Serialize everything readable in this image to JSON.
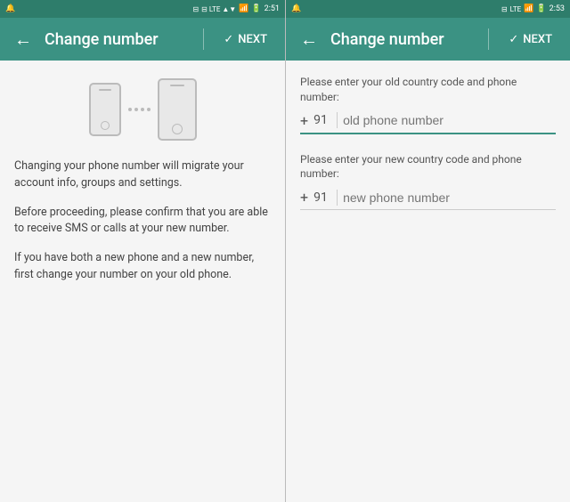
{
  "screen1": {
    "statusBar": {
      "left": "🔔",
      "icons": "⊟ LTE ▲▼",
      "signal": "📶",
      "battery": "🔋",
      "time": "2:51"
    },
    "toolbar": {
      "backIcon": "←",
      "title": "Change number",
      "checkIcon": "✓",
      "nextLabel": "NEXT"
    },
    "illustration": {
      "dots": [
        "•",
        "•",
        "•",
        "•"
      ]
    },
    "paragraphs": [
      "Changing your phone number will migrate your account info, groups and settings.",
      "Before proceeding, please confirm that you are able to receive SMS or calls at your new number.",
      "If you have both a new phone and a new number, first change your number on your old phone."
    ]
  },
  "screen2": {
    "statusBar": {
      "icons": "⊟ LTE ▲▼",
      "time": "2:53"
    },
    "toolbar": {
      "backIcon": "←",
      "title": "Change number",
      "checkIcon": "✓",
      "nextLabel": "NEXT"
    },
    "oldNumberSection": {
      "label": "Please enter your old country code and phone number:",
      "plus": "+",
      "countryCode": "91",
      "placeholder": "old phone number"
    },
    "newNumberSection": {
      "label": "Please enter your new country code and phone number:",
      "plus": "+",
      "countryCode": "91",
      "placeholder": "new phone number"
    }
  }
}
